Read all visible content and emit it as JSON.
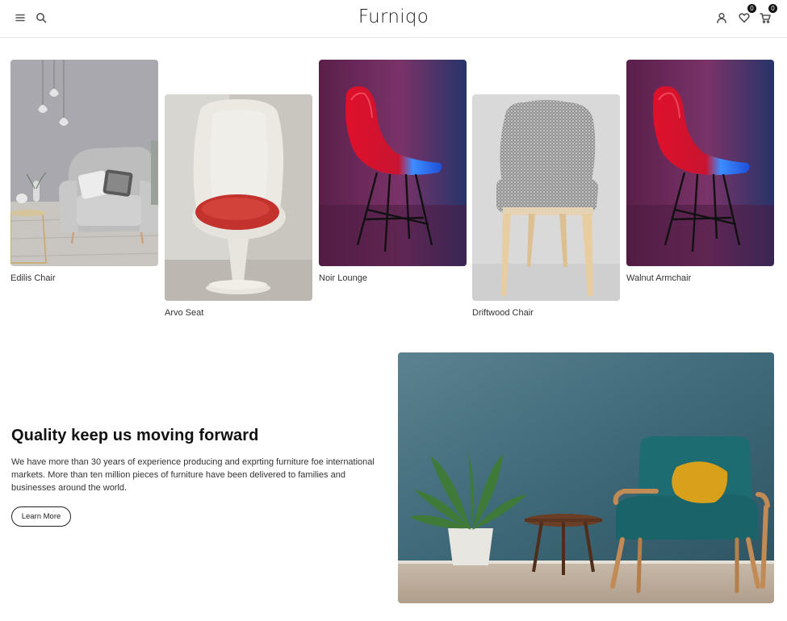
{
  "header": {
    "brand": "Furniqo",
    "wishlist_count": "0",
    "cart_count": "0",
    "icons": [
      "menu-icon",
      "search-icon",
      "user-icon",
      "heart-icon",
      "cart-icon"
    ]
  },
  "products": [
    {
      "name": "Edilis Chair"
    },
    {
      "name": "Arvo Seat"
    },
    {
      "name": "Noir Lounge"
    },
    {
      "name": "Driftwood Chair"
    },
    {
      "name": "Walnut Armchair"
    }
  ],
  "quality": {
    "title": "Quality keep us moving forward",
    "text": "We have more than 30 years of experience producing and exprting furniture foe international markets. More than ten million pieces of furniture have been delivered to families and businesses around the world.",
    "button_label": "Learn More"
  }
}
